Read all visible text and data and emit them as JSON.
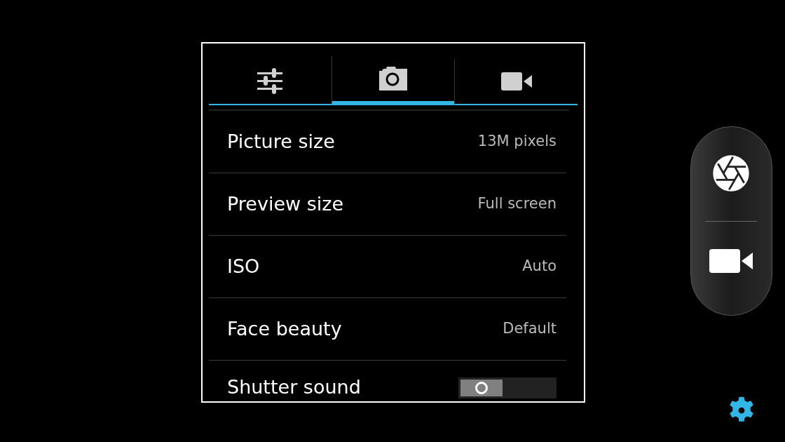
{
  "tabs": [
    {
      "kind": "sliders",
      "selected": false
    },
    {
      "kind": "camera",
      "selected": true
    },
    {
      "kind": "video",
      "selected": false
    }
  ],
  "settings": [
    {
      "kind": "value",
      "label": "Picture size",
      "value": "13M pixels"
    },
    {
      "kind": "value",
      "label": "Preview size",
      "value": "Full screen"
    },
    {
      "kind": "value",
      "label": "ISO",
      "value": "Auto"
    },
    {
      "kind": "value",
      "label": "Face beauty",
      "value": "Default"
    },
    {
      "kind": "toggle",
      "label": "Shutter sound",
      "on": false
    }
  ]
}
